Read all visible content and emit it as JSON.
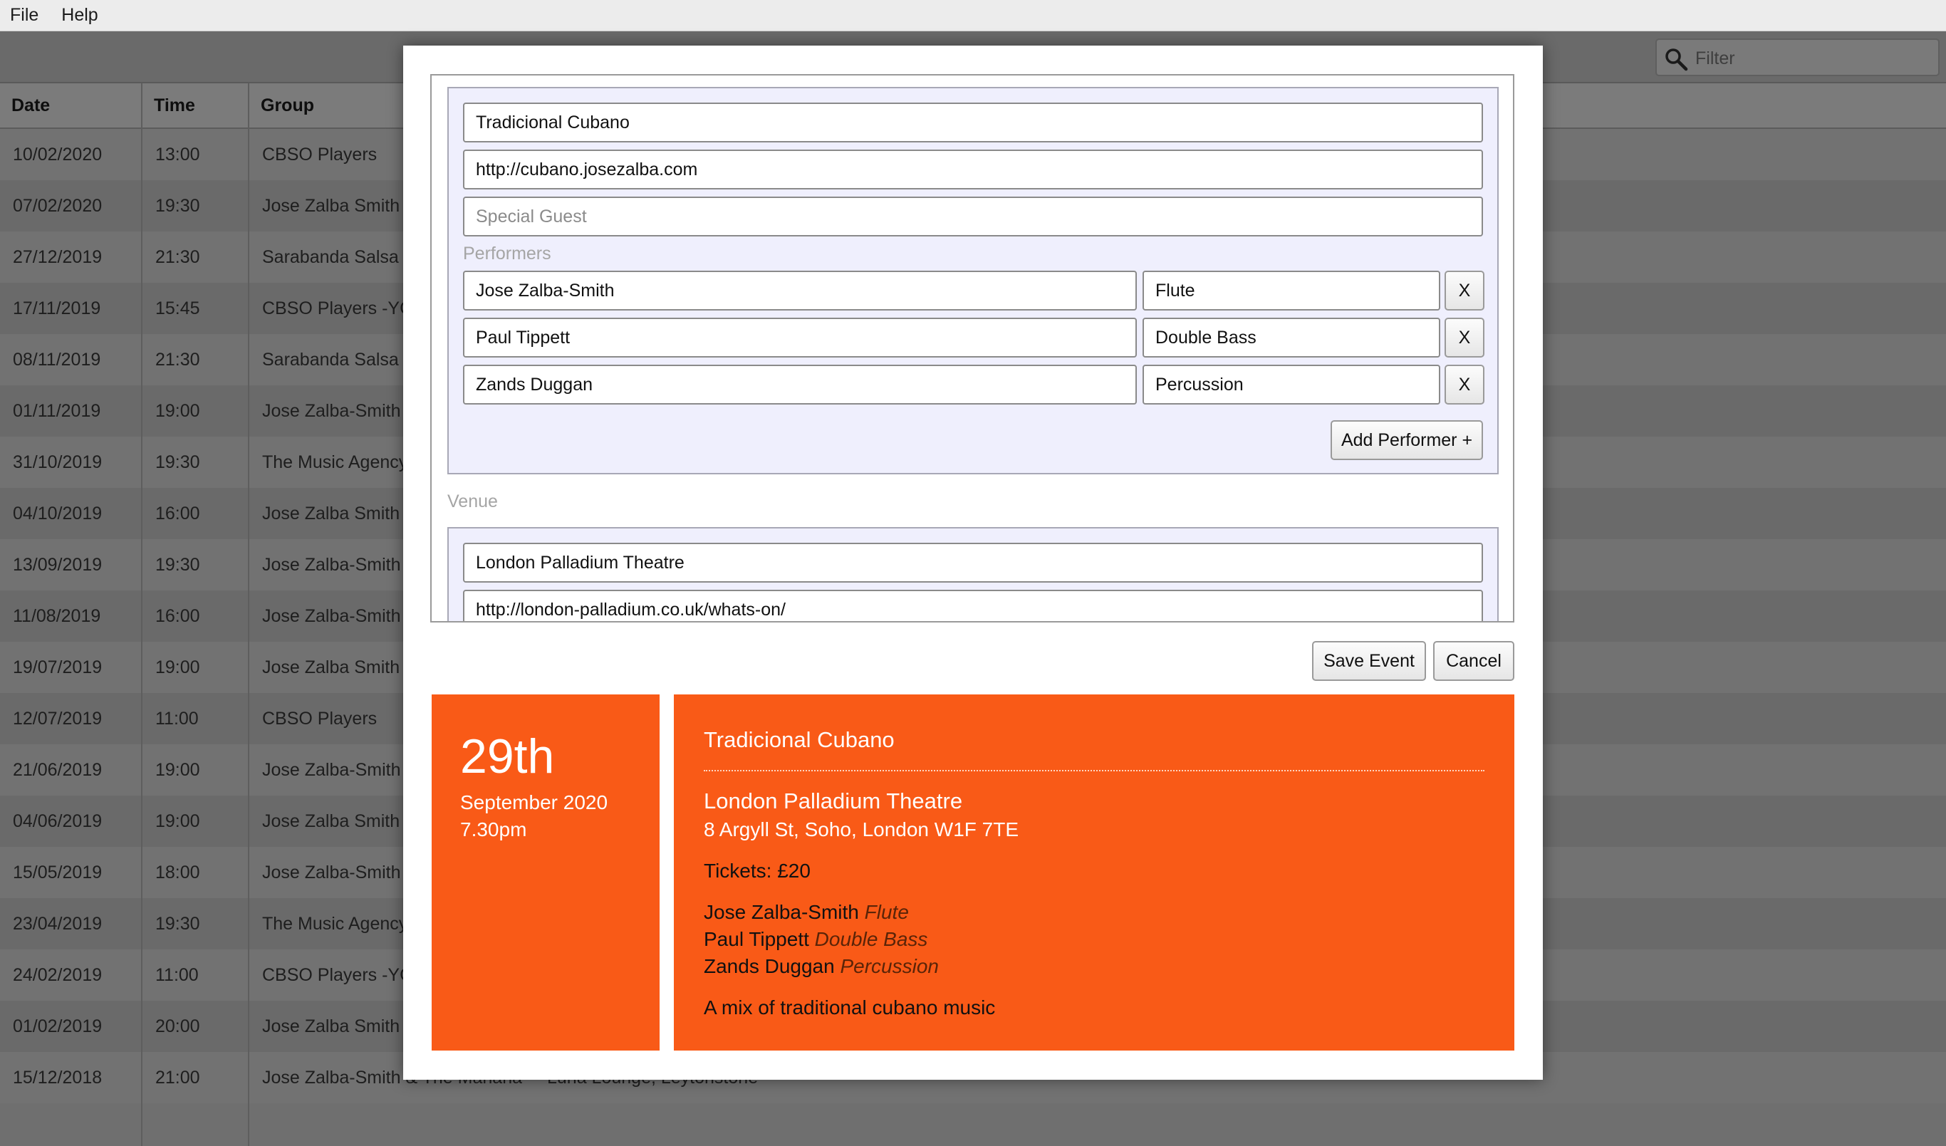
{
  "menu": {
    "file": "File",
    "help": "Help"
  },
  "filter": {
    "placeholder": "Filter"
  },
  "table": {
    "headers": {
      "date": "Date",
      "time": "Time",
      "group": "Group"
    },
    "rows": [
      {
        "date": "10/02/2020",
        "time": "13:00",
        "group": "CBSO Players"
      },
      {
        "date": "07/02/2020",
        "time": "19:30",
        "group": "Jose Zalba Smith"
      },
      {
        "date": "27/12/2019",
        "time": "21:30",
        "group": "Sarabanda Salsa"
      },
      {
        "date": "17/11/2019",
        "time": "15:45",
        "group": "CBSO Players -YC"
      },
      {
        "date": "08/11/2019",
        "time": "21:30",
        "group": "Sarabanda Salsa"
      },
      {
        "date": "01/11/2019",
        "time": "19:00",
        "group": "Jose Zalba-Smith"
      },
      {
        "date": "31/10/2019",
        "time": "19:30",
        "group": "The Music Agency"
      },
      {
        "date": "04/10/2019",
        "time": "16:00",
        "group": "Jose Zalba Smith"
      },
      {
        "date": "13/09/2019",
        "time": "19:30",
        "group": "Jose Zalba-Smith"
      },
      {
        "date": "11/08/2019",
        "time": "16:00",
        "group": "Jose Zalba-Smith"
      },
      {
        "date": "19/07/2019",
        "time": "19:00",
        "group": "Jose Zalba Smith"
      },
      {
        "date": "12/07/2019",
        "time": "11:00",
        "group": "CBSO Players"
      },
      {
        "date": "21/06/2019",
        "time": "19:00",
        "group": "Jose Zalba-Smith"
      },
      {
        "date": "04/06/2019",
        "time": "19:00",
        "group": "Jose Zalba Smith"
      },
      {
        "date": "15/05/2019",
        "time": "18:00",
        "group": "Jose Zalba-Smith"
      },
      {
        "date": "23/04/2019",
        "time": "19:30",
        "group": "The Music Agency"
      },
      {
        "date": "24/02/2019",
        "time": "11:00",
        "group": "CBSO Players -YC"
      },
      {
        "date": "01/02/2019",
        "time": "20:00",
        "group": "Jose Zalba Smith"
      },
      {
        "date": "15/12/2018",
        "time": "21:00",
        "group": "Jose Zalba-Smith & The Mañana",
        "venue": "Luna Lounge, Leytonstone"
      }
    ]
  },
  "form": {
    "group_name": "Tradicional Cubano",
    "group_url": "http://cubano.josezalba.com",
    "special_guest_placeholder": "Special Guest",
    "performers_label": "Performers",
    "performers": [
      {
        "name": "Jose Zalba-Smith",
        "instrument": "Flute",
        "remove_label": "X"
      },
      {
        "name": "Paul Tippett",
        "instrument": "Double Bass",
        "remove_label": "X"
      },
      {
        "name": "Zands Duggan",
        "instrument": "Percussion",
        "remove_label": "X"
      }
    ],
    "add_performer_label": "Add Performer +",
    "venue_label": "Venue",
    "venue_name": "London Palladium Theatre",
    "venue_url": "http://london-palladium.co.uk/whats-on/"
  },
  "actions": {
    "save_label": "Save Event",
    "cancel_label": "Cancel"
  },
  "preview": {
    "day": "29th",
    "month_year": "September 2020",
    "time": "7.30pm",
    "group": "Tradicional Cubano",
    "venue_name": "London Palladium Theatre",
    "venue_address": "8 Argyll St, Soho, London W1F 7TE",
    "tickets": "Tickets: £20",
    "performers": [
      {
        "name": "Jose Zalba-Smith",
        "instrument": "Flute"
      },
      {
        "name": "Paul Tippett",
        "instrument": "Double Bass"
      },
      {
        "name": "Zands Duggan",
        "instrument": "Percussion"
      }
    ],
    "description": "A mix of traditional cubano music"
  },
  "colors": {
    "preview_bg": "#f95a17",
    "panel_bg": "#efeffd",
    "overlay": "#6f6f6f"
  }
}
